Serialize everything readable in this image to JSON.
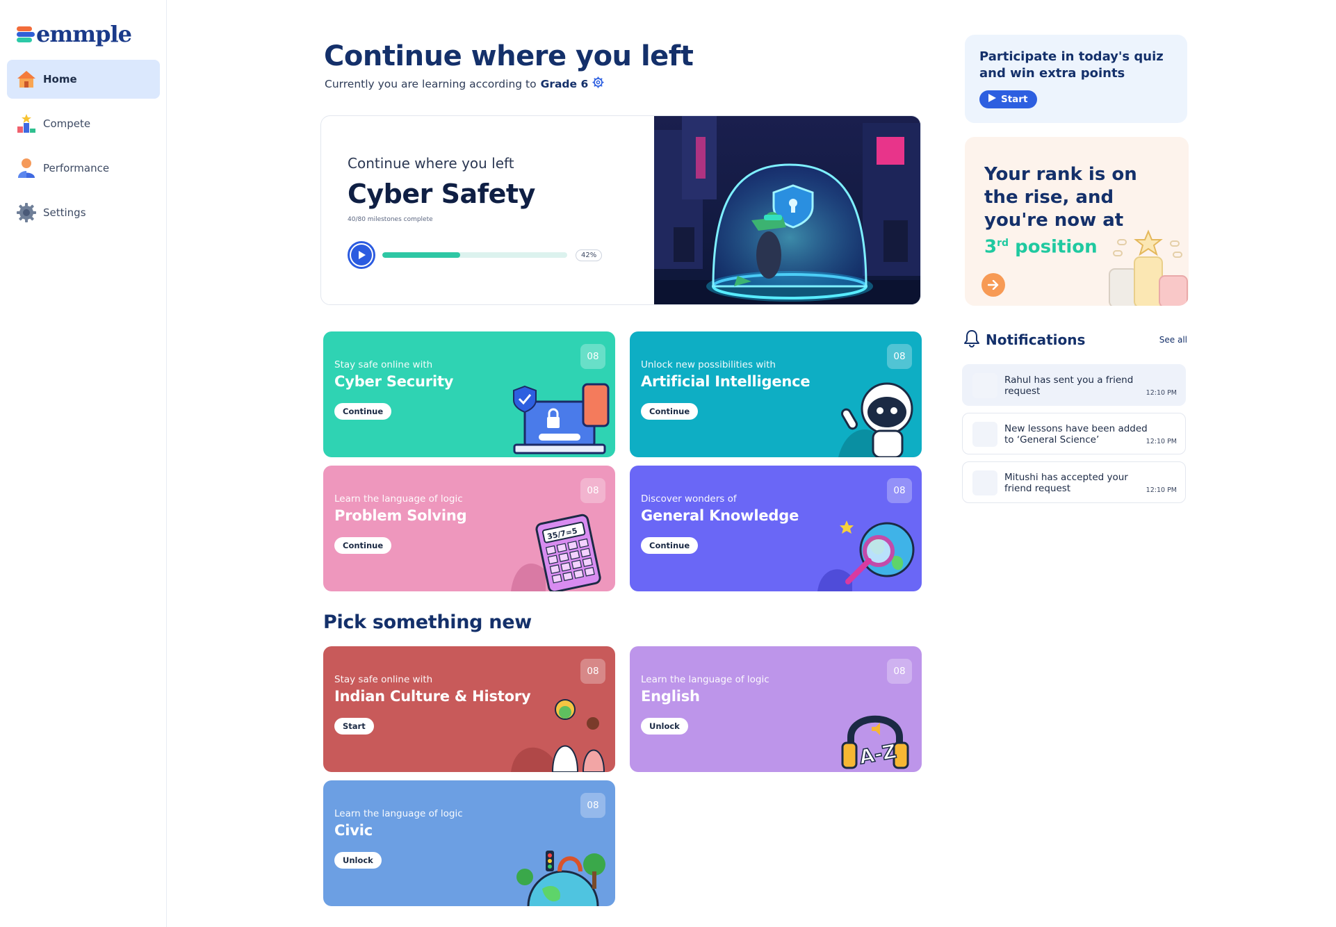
{
  "app": {
    "logo_text": "emmple"
  },
  "sidebar": {
    "items": [
      {
        "label": "Home",
        "icon": "home-icon",
        "active": true
      },
      {
        "label": "Compete",
        "icon": "podium-icon",
        "active": false
      },
      {
        "label": "Performance",
        "icon": "user-icon",
        "active": false
      },
      {
        "label": "Settings",
        "icon": "gear-icon",
        "active": false
      }
    ]
  },
  "header": {
    "title": "Continue where you left",
    "subtitle": "Currently you are learning according to",
    "grade": "Grade 6"
  },
  "hero": {
    "kicker": "Continue where you left",
    "title": "Cyber Safety",
    "milestones": "40/80 milestones complete",
    "progress_percent": 42,
    "progress_label": "42%"
  },
  "continue_cards": [
    {
      "kicker": "Stay safe online with",
      "title": "Cyber Security",
      "button": "Continue",
      "count": "08",
      "color": "#2fd3b3",
      "icon": "laptop-lock-icon"
    },
    {
      "kicker": "Unlock new possibilities with",
      "title": "Artificial Intelligence",
      "button": "Continue",
      "count": "08",
      "color": "#0eaec4",
      "icon": "robot-icon"
    },
    {
      "kicker": "Learn the language of logic",
      "title": "Problem Solving",
      "button": "Continue",
      "count": "08",
      "color": "#ee97bd",
      "icon": "calculator-icon"
    },
    {
      "kicker": "Discover wonders of",
      "title": "General Knowledge",
      "button": "Continue",
      "count": "08",
      "color": "#6a67f6",
      "icon": "globe-magnifier-icon"
    }
  ],
  "pick_section": {
    "title": "Pick something new"
  },
  "new_cards": [
    {
      "kicker": "Stay safe online with",
      "title": "Indian Culture & History",
      "button": "Start",
      "count": "08",
      "color": "#c85a5a",
      "icon": "dancers-icon"
    },
    {
      "kicker": "Learn the language of logic",
      "title": "English",
      "button": "Unlock",
      "count": "08",
      "color": "#bd95ea",
      "icon": "headphones-az-icon"
    },
    {
      "kicker": "Learn the language of logic",
      "title": "Civic",
      "button": "Unlock",
      "count": "08",
      "color": "#6c9fe3",
      "icon": "globe-city-icon"
    }
  ],
  "quiz": {
    "text": "Participate in today's quiz and win extra points",
    "button": "Start"
  },
  "rank": {
    "line1": "Your rank is on the rise, and you're now at",
    "position": "3",
    "suffix": "rd",
    "line2": "position"
  },
  "notifications": {
    "title": "Notifications",
    "see_all": "See all",
    "items": [
      {
        "message": "Rahul has sent you a friend request",
        "time": "12:10 PM",
        "unread": true
      },
      {
        "message": "New lessons have been added to ‘General Science’",
        "time": "12:10 PM",
        "unread": false
      },
      {
        "message": "Mitushi has accepted your friend request",
        "time": "12:10 PM",
        "unread": false
      }
    ]
  }
}
